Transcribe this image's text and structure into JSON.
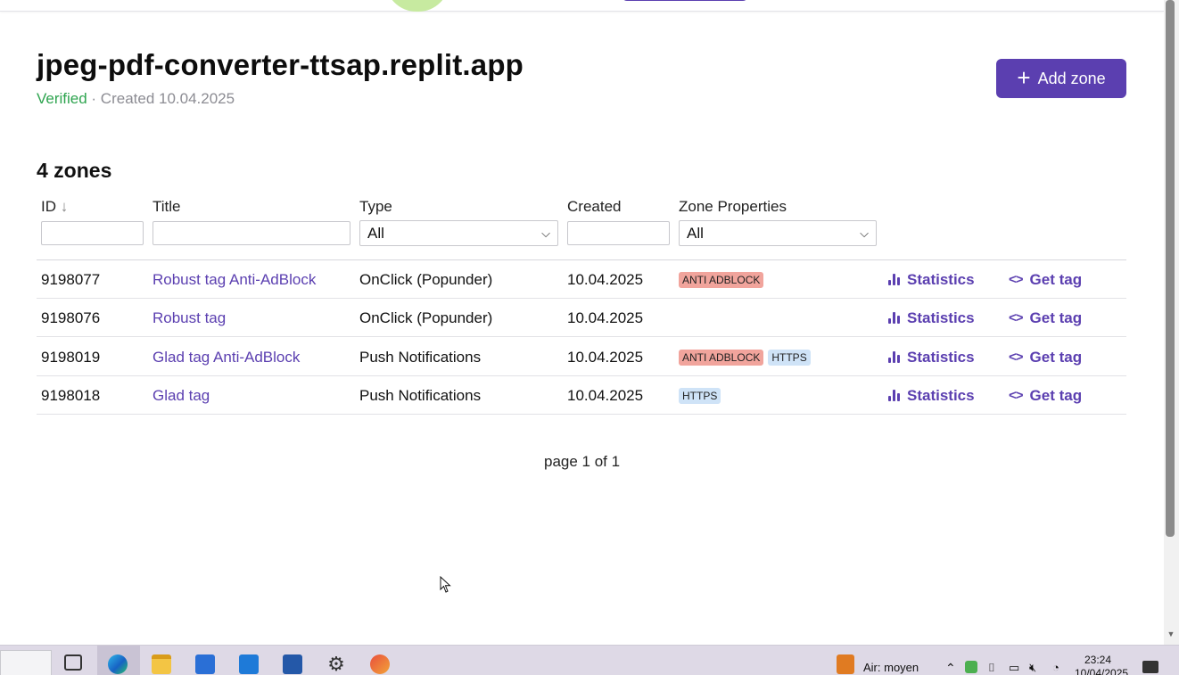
{
  "site": {
    "title": "jpeg-pdf-converter-ttsap.replit.app",
    "status": "Verified",
    "created_text": " · Created 10.04.2025"
  },
  "add_zone_label": "Add zone",
  "zones_count": "4 zones",
  "columns": {
    "id": "ID",
    "title": "Title",
    "type": "Type",
    "created": "Created",
    "zone_properties": "Zone Properties"
  },
  "filters": {
    "type_selected": "All",
    "zone_properties_selected": "All"
  },
  "rows": [
    {
      "id": "9198077",
      "title": "Robust tag Anti-AdBlock",
      "type": "OnClick (Popunder)",
      "created": "10.04.2025",
      "badges": [
        "ANTI ADBLOCK"
      ]
    },
    {
      "id": "9198076",
      "title": "Robust tag",
      "type": "OnClick (Popunder)",
      "created": "10.04.2025",
      "badges": []
    },
    {
      "id": "9198019",
      "title": "Glad tag Anti-AdBlock",
      "type": "Push Notifications",
      "created": "10.04.2025",
      "badges": [
        "ANTI ADBLOCK",
        "HTTPS"
      ]
    },
    {
      "id": "9198018",
      "title": "Glad tag",
      "type": "Push Notifications",
      "created": "10.04.2025",
      "badges": [
        "HTTPS"
      ]
    }
  ],
  "row_actions": {
    "statistics": "Statistics",
    "get_tag": "Get tag"
  },
  "pagination": "page 1 of 1",
  "colors": {
    "accent": "#5b3fb0",
    "verified": "#2ea44f",
    "badge_red": "#f1a49c",
    "badge_blue": "#cfe3f7"
  },
  "taskbar": {
    "weather": "Air: moyen",
    "time": "23:24",
    "date": "10/04/2025"
  }
}
